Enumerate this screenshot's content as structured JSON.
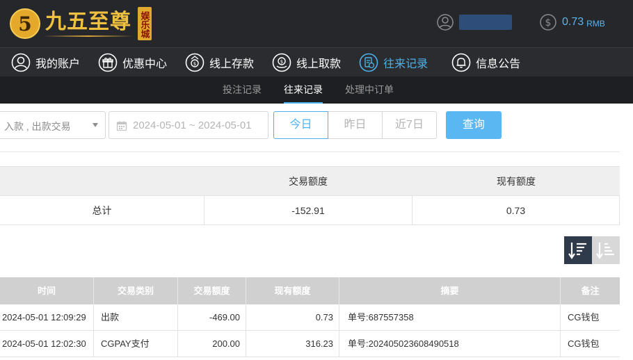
{
  "brand": {
    "logo_glyph": "5",
    "title": "九五至尊",
    "tag": "娱乐城",
    "gold": "#f0c040"
  },
  "header": {
    "balance_value": "0.73",
    "balance_unit": "RMB",
    "accent": "#5ab4ee"
  },
  "nav": {
    "items": [
      {
        "label": "我的账户",
        "icon": "user-circle-icon"
      },
      {
        "label": "优惠中心",
        "icon": "gift-icon"
      },
      {
        "label": "线上存款",
        "icon": "deposit-icon"
      },
      {
        "label": "线上取款",
        "icon": "withdraw-icon"
      },
      {
        "label": "往来记录",
        "icon": "records-icon",
        "active": true
      },
      {
        "label": "信息公告",
        "icon": "bell-icon"
      }
    ],
    "active_color": "#4db2ec"
  },
  "subnav": {
    "tabs": [
      {
        "label": "投注记录"
      },
      {
        "label": "往来记录",
        "active": true
      },
      {
        "label": "处理中订单"
      }
    ]
  },
  "filters": {
    "type_selected": "入款 , 出款交易",
    "date_range": "2024-05-01 ~ 2024-05-01",
    "quick": [
      {
        "label": "今日",
        "active": true
      },
      {
        "label": "昨日"
      },
      {
        "label": "近7日"
      }
    ],
    "query_label": "查询"
  },
  "summary": {
    "headers": [
      "",
      "交易额度",
      "现有额度"
    ],
    "row": {
      "label": "总计",
      "trade_amount": "-152.91",
      "current_amount": "0.73"
    }
  },
  "records": {
    "headers": [
      "时间",
      "交易类别",
      "交易额度",
      "现有额度",
      "摘要",
      "备注"
    ],
    "rows": [
      {
        "time": "2024-05-01 12:09:29",
        "type": "出款",
        "amount": "-469.00",
        "balance": "0.73",
        "summary": "单号:687557358",
        "note": "CG钱包"
      },
      {
        "time": "2024-05-01 12:02:30",
        "type": "CGPAY支付",
        "amount": "200.00",
        "balance": "316.23",
        "summary": "单号:202405023608490518",
        "note": "CG钱包"
      }
    ]
  }
}
